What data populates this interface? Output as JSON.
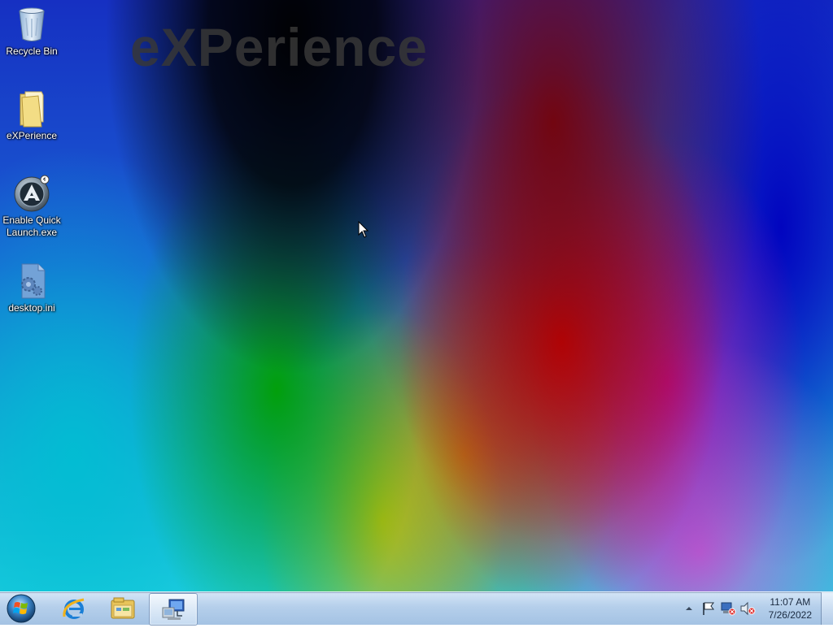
{
  "wallpaper": {
    "logo_text": "eXPerience"
  },
  "desktop_icons": [
    {
      "label": "Recycle Bin",
      "icon": "recycle-bin-icon"
    },
    {
      "label": "eXPerience",
      "icon": "folder-icon"
    },
    {
      "label": "Enable Quick Launch.exe",
      "icon": "app-exe-icon"
    },
    {
      "label": "desktop.ini",
      "icon": "settings-file-icon"
    }
  ],
  "taskbar": {
    "start": {
      "icon": "windows-start-orb-icon"
    },
    "pinned": [
      {
        "name": "Internet Explorer",
        "icon": "internet-explorer-icon"
      },
      {
        "name": "Windows Explorer",
        "icon": "file-explorer-icon"
      },
      {
        "name": "Control Panel",
        "icon": "computer-network-icon",
        "active": true
      }
    ],
    "tray": {
      "icons": [
        "show-hidden-icons-arrow",
        "action-center-flag-icon",
        "network-icon",
        "volume-muted-icon"
      ],
      "time": "11:07 AM",
      "date": "7/26/2022"
    }
  },
  "colors": {
    "taskbar_top": "#d2e4f6",
    "taskbar_bottom": "#a0c0e2",
    "icon_text": "#ffffff",
    "clock_text": "#1a2a40"
  }
}
